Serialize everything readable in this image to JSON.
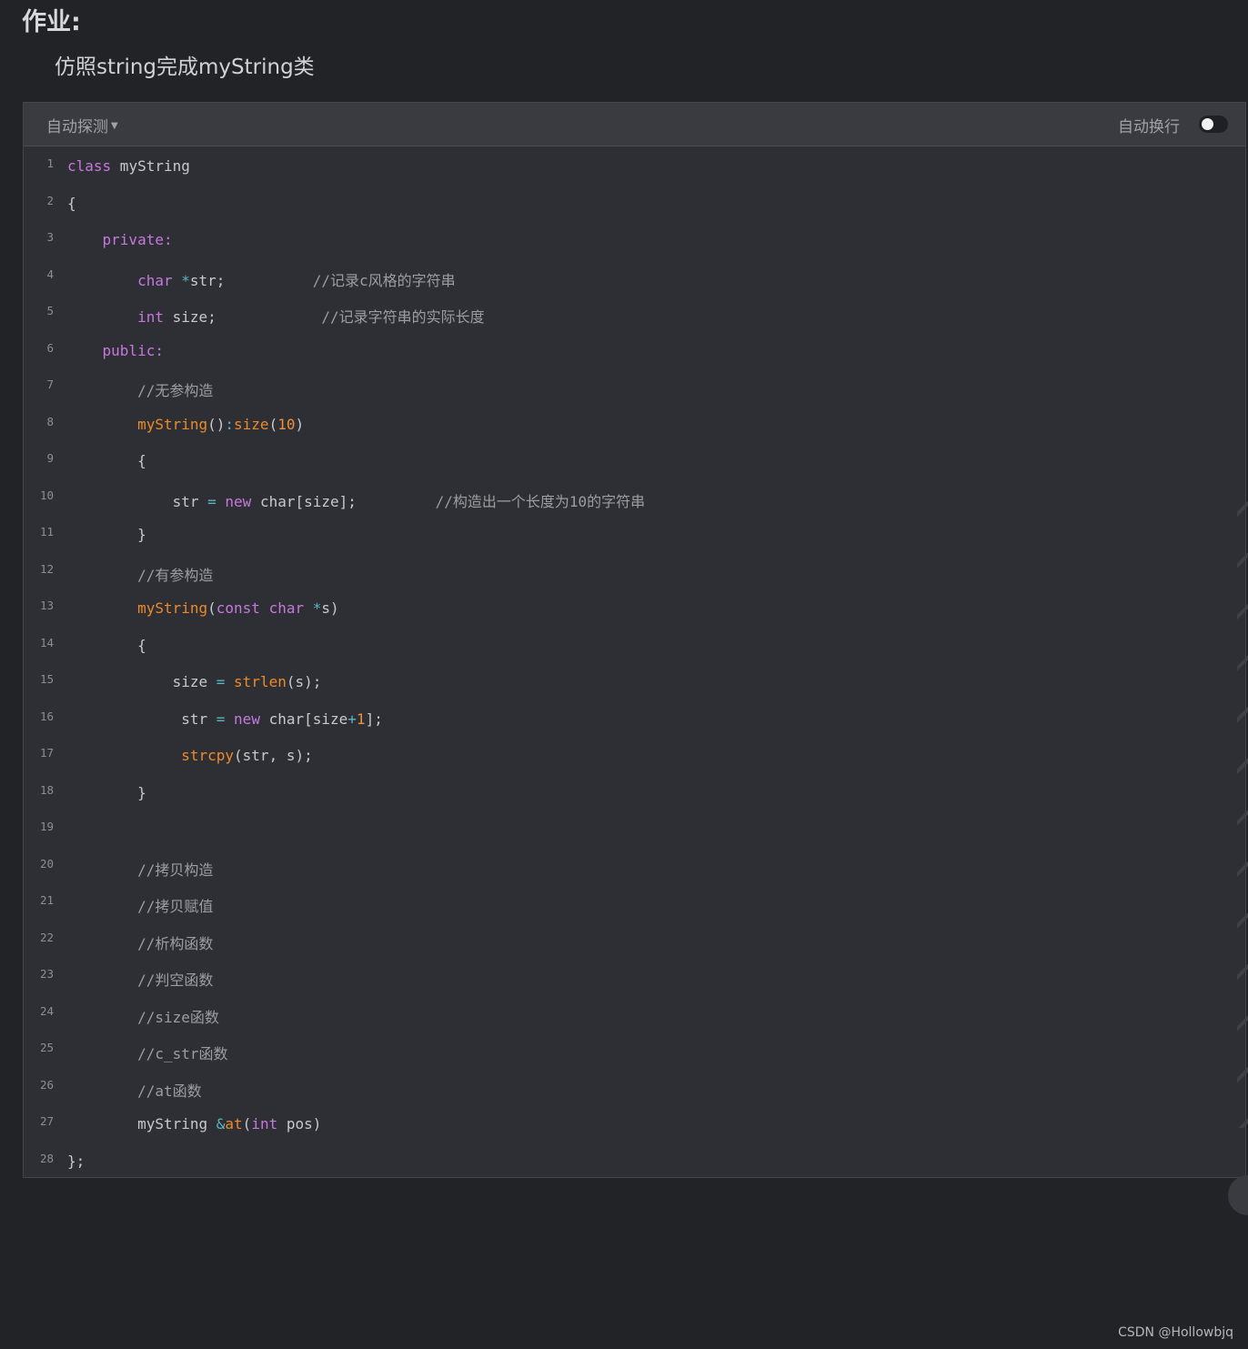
{
  "page": {
    "heading": "作业:",
    "subheading": "仿照string完成myString类",
    "watermark": "CSDN @Hollowbjq"
  },
  "toolbar": {
    "language_label": "自动探测",
    "wrap_label": "自动换行",
    "wrap_enabled": false
  },
  "code_lines": [
    {
      "n": "1",
      "tokens": [
        {
          "t": "class",
          "c": "kw"
        },
        {
          "t": " myString"
        }
      ]
    },
    {
      "n": "2",
      "tokens": [
        {
          "t": "{"
        }
      ]
    },
    {
      "n": "3",
      "tokens": [
        {
          "t": "    "
        },
        {
          "t": "private:",
          "c": "kw"
        }
      ]
    },
    {
      "n": "4",
      "tokens": [
        {
          "t": "        "
        },
        {
          "t": "char",
          "c": "kw"
        },
        {
          "t": " "
        },
        {
          "t": "*",
          "c": "op"
        },
        {
          "t": "str;          "
        },
        {
          "t": "//记录c风格的字符串",
          "c": "cm"
        }
      ]
    },
    {
      "n": "5",
      "tokens": [
        {
          "t": "        "
        },
        {
          "t": "int",
          "c": "kw"
        },
        {
          "t": " size;            "
        },
        {
          "t": "//记录字符串的实际长度",
          "c": "cm"
        }
      ]
    },
    {
      "n": "6",
      "tokens": [
        {
          "t": "    "
        },
        {
          "t": "public:",
          "c": "kw"
        }
      ]
    },
    {
      "n": "7",
      "tokens": [
        {
          "t": "        "
        },
        {
          "t": "//无参构造",
          "c": "cm"
        }
      ]
    },
    {
      "n": "8",
      "tokens": [
        {
          "t": "        "
        },
        {
          "t": "myString",
          "c": "fn"
        },
        {
          "t": "()"
        },
        {
          "t": ":",
          "c": "op"
        },
        {
          "t": "size",
          "c": "fn"
        },
        {
          "t": "("
        },
        {
          "t": "10",
          "c": "num"
        },
        {
          "t": ")"
        }
      ]
    },
    {
      "n": "9",
      "tokens": [
        {
          "t": "        {"
        }
      ]
    },
    {
      "n": "10",
      "tokens": [
        {
          "t": "            str "
        },
        {
          "t": "=",
          "c": "op"
        },
        {
          "t": " "
        },
        {
          "t": "new",
          "c": "kw"
        },
        {
          "t": " char[size];         "
        },
        {
          "t": "//构造出一个长度为10的字符串",
          "c": "cm"
        }
      ]
    },
    {
      "n": "11",
      "tokens": [
        {
          "t": "        }"
        }
      ]
    },
    {
      "n": "12",
      "tokens": [
        {
          "t": "        "
        },
        {
          "t": "//有参构造",
          "c": "cm"
        }
      ]
    },
    {
      "n": "13",
      "tokens": [
        {
          "t": "        "
        },
        {
          "t": "myString",
          "c": "fn"
        },
        {
          "t": "("
        },
        {
          "t": "const",
          "c": "kw"
        },
        {
          "t": " "
        },
        {
          "t": "char",
          "c": "kw"
        },
        {
          "t": " "
        },
        {
          "t": "*",
          "c": "op"
        },
        {
          "t": "s)"
        }
      ]
    },
    {
      "n": "14",
      "tokens": [
        {
          "t": "        {"
        }
      ]
    },
    {
      "n": "15",
      "tokens": [
        {
          "t": "            size "
        },
        {
          "t": "=",
          "c": "op"
        },
        {
          "t": " "
        },
        {
          "t": "strlen",
          "c": "fn"
        },
        {
          "t": "(s);"
        }
      ]
    },
    {
      "n": "16",
      "tokens": [
        {
          "t": "             str "
        },
        {
          "t": "=",
          "c": "op"
        },
        {
          "t": " "
        },
        {
          "t": "new",
          "c": "kw"
        },
        {
          "t": " char[size"
        },
        {
          "t": "+",
          "c": "op"
        },
        {
          "t": "1",
          "c": "num"
        },
        {
          "t": "];"
        }
      ]
    },
    {
      "n": "17",
      "tokens": [
        {
          "t": "             "
        },
        {
          "t": "strcpy",
          "c": "fn"
        },
        {
          "t": "(str, s);"
        }
      ]
    },
    {
      "n": "18",
      "tokens": [
        {
          "t": "        }"
        }
      ]
    },
    {
      "n": "19",
      "tokens": []
    },
    {
      "n": "20",
      "tokens": [
        {
          "t": "        "
        },
        {
          "t": "//拷贝构造",
          "c": "cm"
        }
      ]
    },
    {
      "n": "21",
      "tokens": [
        {
          "t": "        "
        },
        {
          "t": "//拷贝赋值",
          "c": "cm"
        }
      ]
    },
    {
      "n": "22",
      "tokens": [
        {
          "t": "        "
        },
        {
          "t": "//析构函数",
          "c": "cm"
        }
      ]
    },
    {
      "n": "23",
      "tokens": [
        {
          "t": "        "
        },
        {
          "t": "//判空函数",
          "c": "cm"
        }
      ]
    },
    {
      "n": "24",
      "tokens": [
        {
          "t": "        "
        },
        {
          "t": "//size函数",
          "c": "cm"
        }
      ]
    },
    {
      "n": "25",
      "tokens": [
        {
          "t": "        "
        },
        {
          "t": "//c_str函数",
          "c": "cm"
        }
      ]
    },
    {
      "n": "26",
      "tokens": [
        {
          "t": "        "
        },
        {
          "t": "//at函数",
          "c": "cm"
        }
      ]
    },
    {
      "n": "27",
      "tokens": [
        {
          "t": "        myString "
        },
        {
          "t": "&",
          "c": "op"
        },
        {
          "t": "at",
          "c": "fn"
        },
        {
          "t": "("
        },
        {
          "t": "int",
          "c": "kw"
        },
        {
          "t": " pos)"
        }
      ]
    },
    {
      "n": "28",
      "tokens": [
        {
          "t": "};"
        }
      ]
    }
  ]
}
